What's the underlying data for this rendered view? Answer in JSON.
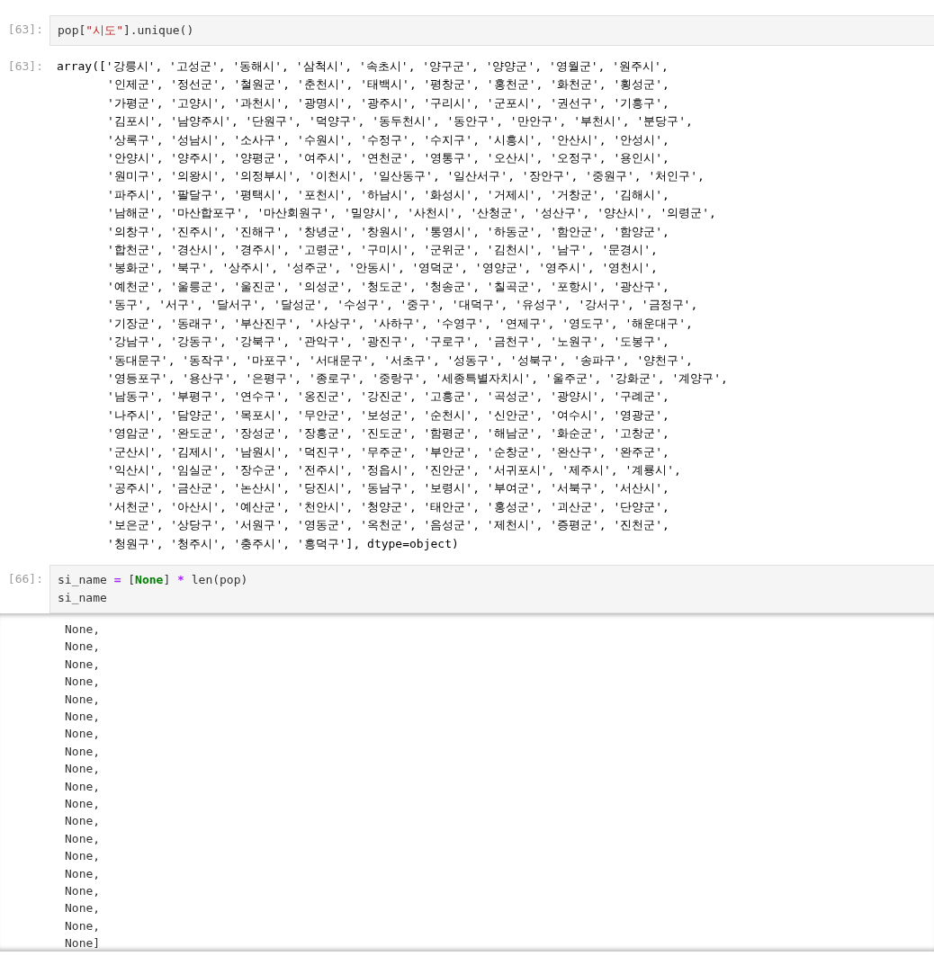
{
  "cells": [
    {
      "input_prompt": "[63]:",
      "code": [
        [
          {
            "kind": "plain",
            "text": "pop["
          },
          {
            "kind": "string",
            "text": "\"시도\""
          },
          {
            "kind": "plain",
            "text": "].unique()"
          }
        ]
      ],
      "output_prompt": "[63]:",
      "output": [
        "array(['강릉시', '고성군', '동해시', '삼척시', '속초시', '양구군', '양양군', '영월군', '원주시',",
        "'인제군', '정선군', '철원군', '춘천시', '태백시', '평창군', '홍천군', '화천군', '횡성군',",
        "'가평군', '고양시', '과천시', '광명시', '광주시', '구리시', '군포시', '권선구', '기흥구',",
        "'김포시', '남양주시', '단원구', '덕양구', '동두천시', '동안구', '만안구', '부천시', '분당구',",
        "'상록구', '성남시', '소사구', '수원시', '수정구', '수지구', '시흥시', '안산시', '안성시',",
        "'안양시', '양주시', '양평군', '여주시', '연천군', '영통구', '오산시', '오정구', '용인시',",
        "'원미구', '의왕시', '의정부시', '이천시', '일산동구', '일산서구', '장안구', '중원구', '처인구',",
        "'파주시', '팔달구', '평택시', '포천시', '하남시', '화성시', '거제시', '거창군', '김해시',",
        "'남해군', '마산합포구', '마산회원구', '밀양시', '사천시', '산청군', '성산구', '양산시', '의령군',",
        "'의창구', '진주시', '진해구', '창녕군', '창원시', '통영시', '하동군', '함안군', '함양군',",
        "'합천군', '경산시', '경주시', '고령군', '구미시', '군위군', '김천시', '남구', '문경시',",
        "'봉화군', '북구', '상주시', '성주군', '안동시', '영덕군', '영양군', '영주시', '영천시',",
        "'예천군', '울릉군', '울진군', '의성군', '청도군', '청송군', '칠곡군', '포항시', '광산구',",
        "'동구', '서구', '달서구', '달성군', '수성구', '중구', '대덕구', '유성구', '강서구', '금정구',",
        "'기장군', '동래구', '부산진구', '사상구', '사하구', '수영구', '연제구', '영도구', '해운대구',",
        "'강남구', '강동구', '강북구', '관악구', '광진구', '구로구', '금천구', '노원구', '도봉구',",
        "'동대문구', '동작구', '마포구', '서대문구', '서초구', '성동구', '성북구', '송파구', '양천구',",
        "'영등포구', '용산구', '은평구', '종로구', '중랑구', '세종특별자치시', '울주군', '강화군', '계양구',",
        "'남동구', '부평구', '연수구', '옹진군', '강진군', '고흥군', '곡성군', '광양시', '구례군',",
        "'나주시', '담양군', '목포시', '무안군', '보성군', '순천시', '신안군', '여수시', '영광군',",
        "'영암군', '완도군', '장성군', '장흥군', '진도군', '함평군', '해남군', '화순군', '고창군',",
        "'군산시', '김제시', '남원시', '덕진구', '무주군', '부안군', '순창군', '완산구', '완주군',",
        "'익산시', '임실군', '장수군', '전주시', '정읍시', '진안군', '서귀포시', '제주시', '계룡시',",
        "'공주시', '금산군', '논산시', '당진시', '동남구', '보령시', '부여군', '서북구', '서산시',",
        "'서천군', '아산시', '예산군', '천안시', '청양군', '태안군', '홍성군', '괴산군', '단양군',",
        "'보은군', '상당구', '서원구', '영동군', '옥천군', '음성군', '제천시', '증평군', '진천군',",
        "'청원구', '청주시', '충주시', '흥덕구'], dtype=object)"
      ]
    },
    {
      "input_prompt": "[66]:",
      "code": [
        [
          {
            "kind": "plain",
            "text": "si_name "
          },
          {
            "kind": "operator",
            "text": "="
          },
          {
            "kind": "plain",
            "text": " ["
          },
          {
            "kind": "keyword",
            "text": "None"
          },
          {
            "kind": "plain",
            "text": "] "
          },
          {
            "kind": "operator",
            "text": "*"
          },
          {
            "kind": "plain",
            "text": " len(pop)"
          }
        ],
        [
          {
            "kind": "plain",
            "text": "si_name"
          }
        ]
      ],
      "scrolled": true,
      "output": [
        "None,",
        "None,",
        "None,",
        "None,",
        "None,",
        "None,",
        "None,",
        "None,",
        "None,",
        "None,",
        "None,",
        "None,",
        "None,",
        "None,",
        "None,",
        "None,",
        "None,",
        "None,",
        "None]"
      ]
    }
  ]
}
